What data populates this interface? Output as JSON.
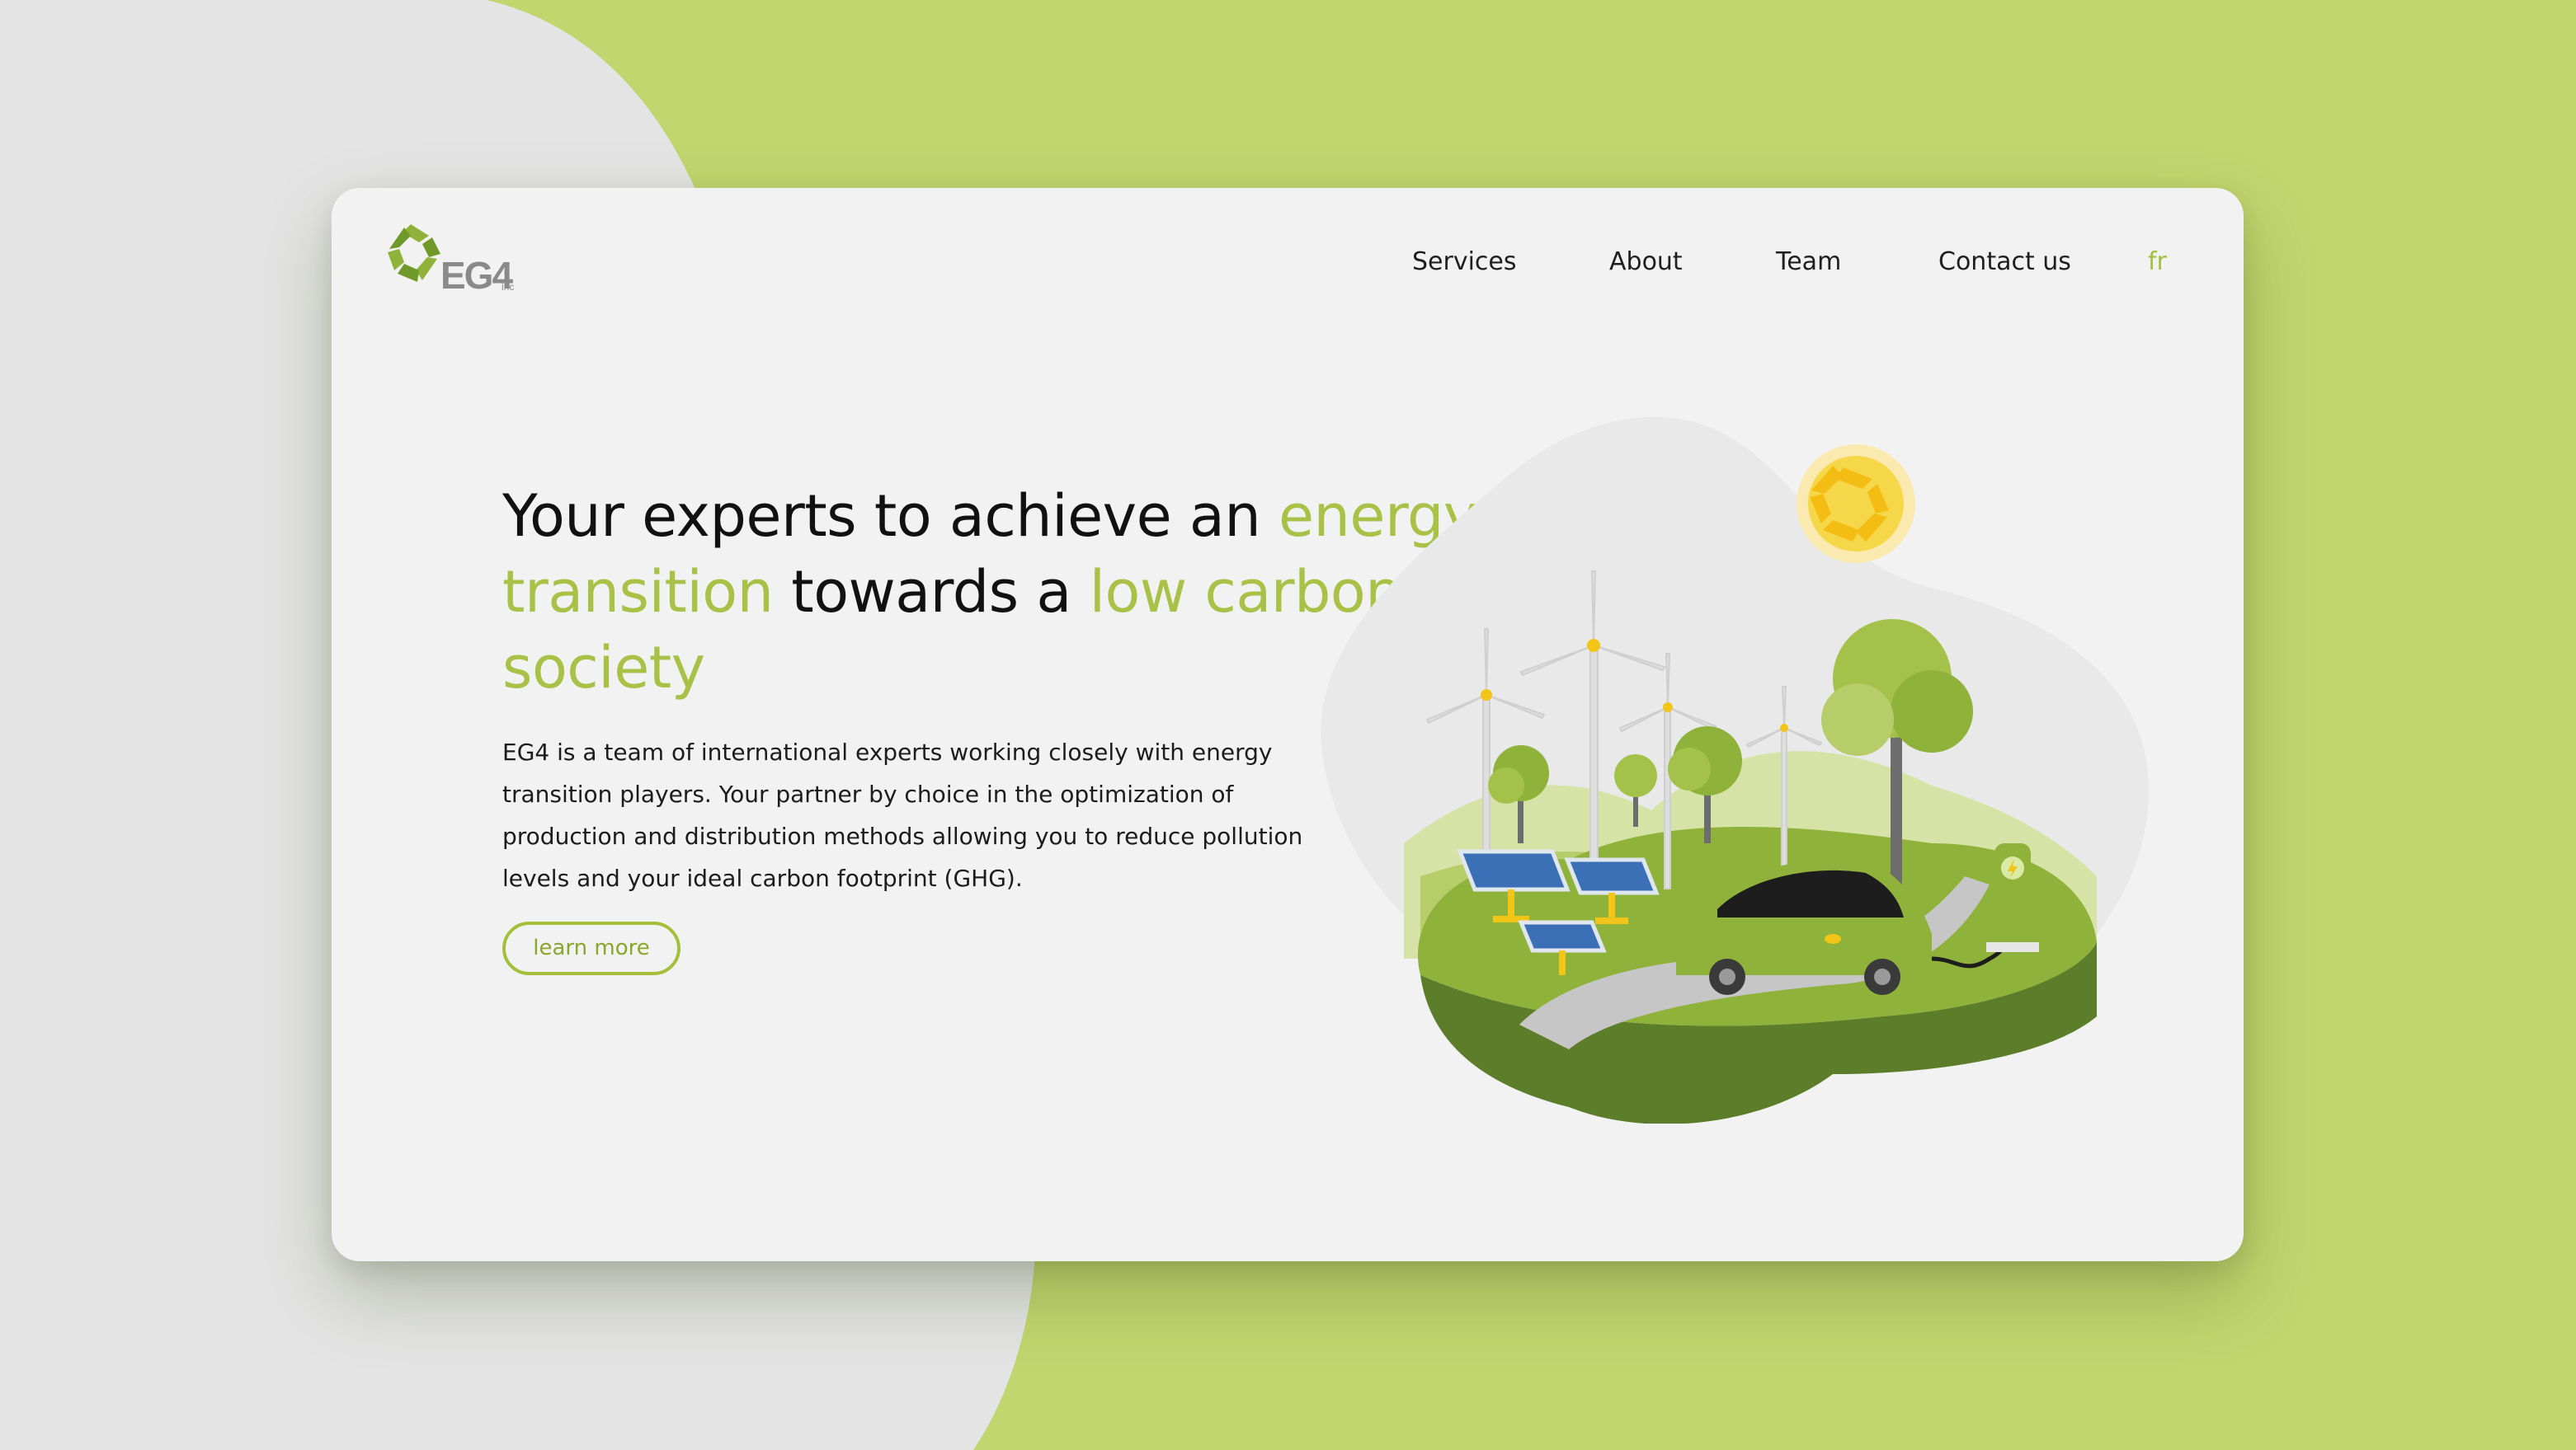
{
  "brand": {
    "logo_text": "EG4",
    "logo_suffix": "inc",
    "accent_color": "#a9c146",
    "background_color": "#c3d56f"
  },
  "nav": {
    "items": [
      "Services",
      "About",
      "Team",
      "Contact us"
    ],
    "language": "fr"
  },
  "hero": {
    "headline_part1": "Your experts to achieve an",
    "headline_highlight1": "energy transition",
    "headline_part2": "towards a",
    "headline_highlight2": "low carbon society",
    "description": "EG4 is a team of international experts working closely with energy transition players. Your partner by choice in the optimization of production and distribution methods allowing you to reduce pollution levels and your ideal carbon footprint (GHG).",
    "cta_label": "learn more"
  },
  "illustration": {
    "icons": [
      "wind-turbine-icon",
      "solar-panel-icon",
      "tree-icon",
      "electric-car-icon",
      "charging-station-icon",
      "sun-logo-icon"
    ]
  }
}
